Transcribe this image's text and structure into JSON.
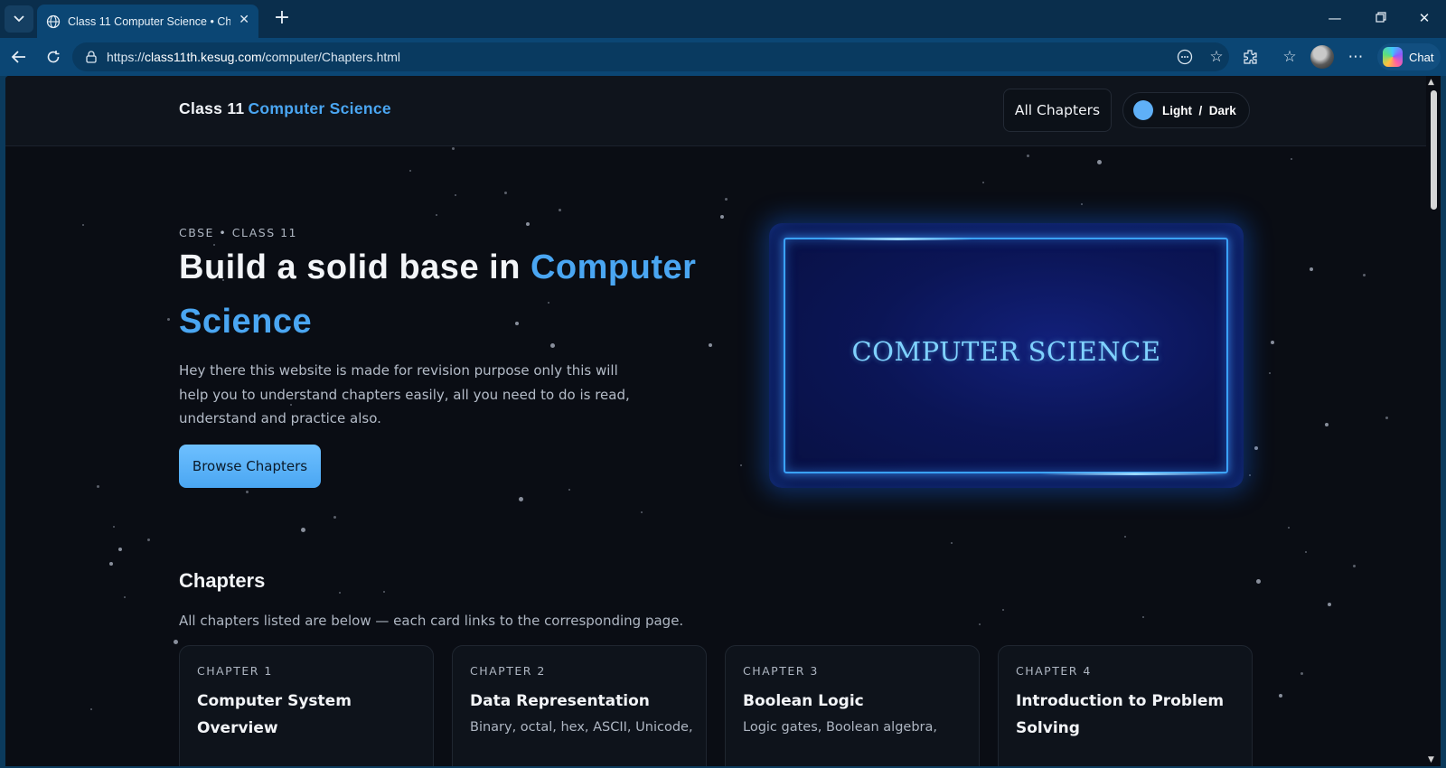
{
  "browser": {
    "tab_title": "Class 11 Computer Science • Chapters",
    "url_scheme": "https://",
    "url_host": "class11th.kesug.com",
    "url_path": "/computer/Chapters.html",
    "chat_label": "Chat"
  },
  "site": {
    "brand_prefix": "Class 11",
    "brand_accent": "Computer Science",
    "nav_all_chapters": "All Chapters",
    "theme_toggle": "Light  /  Dark",
    "accent_color": "#4aa6f2"
  },
  "hero": {
    "kicker": "CBSE • CLASS 11",
    "title_prefix": "Build a solid base in",
    "title_accent": "Computer Science",
    "description": "Hey there this website is made for revision purpose only this will help you to understand chapters easily, all you need to do is read, understand and practice also.",
    "cta": "Browse Chapters",
    "card_text": "COMPUTER SCIENCE"
  },
  "chapters": {
    "title": "Chapters",
    "description": "All chapters listed are below — each card links to the corresponding page.",
    "items": [
      {
        "kicker": "CHAPTER 1",
        "title": "Computer System Overview",
        "desc": ""
      },
      {
        "kicker": "CHAPTER 2",
        "title": "Data Representation",
        "desc": "Binary, octal, hex, ASCII, Unicode,"
      },
      {
        "kicker": "CHAPTER 3",
        "title": "Boolean Logic",
        "desc": "Logic gates, Boolean algebra,"
      },
      {
        "kicker": "CHAPTER 4",
        "title": "Introduction to Problem Solving",
        "desc": ""
      }
    ]
  }
}
